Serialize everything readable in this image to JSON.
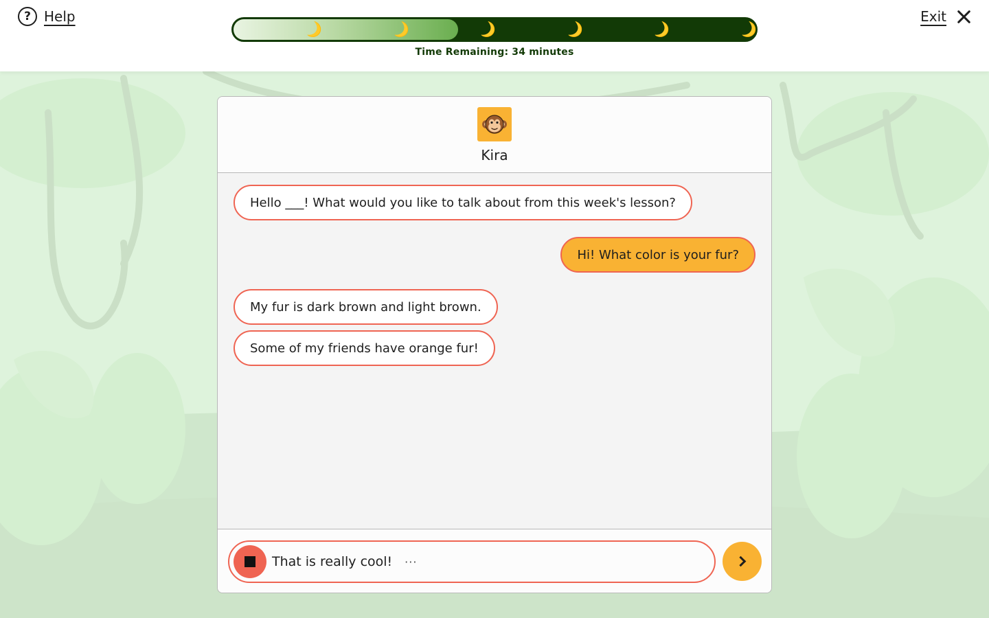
{
  "header": {
    "help_label": "Help",
    "help_icon_glyph": "?",
    "exit_label": "Exit",
    "time_remaining": "Time Remaining: 34 minutes",
    "progress_fraction": 0.43,
    "milestone_count": 6,
    "milestone_icon": "banana-icon",
    "milestone_glyph": "🌙"
  },
  "chat": {
    "bot_name": "Kira",
    "avatar_icon": "monkey-icon",
    "messages": [
      {
        "sender": "bot",
        "text": "Hello ___! What would you like to talk about from this week's lesson?"
      },
      {
        "sender": "user",
        "text": "Hi! What color is your fur?"
      },
      {
        "sender": "bot",
        "text": "My fur is dark brown and light brown."
      },
      {
        "sender": "bot",
        "text": "Some of my friends have orange fur!"
      }
    ]
  },
  "composer": {
    "input_value": "That is really cool!",
    "typing_indicator": "···",
    "stop_icon": "stop-icon",
    "send_icon": "chevron-right-icon"
  },
  "colors": {
    "accent_orange": "#f9b233",
    "bubble_border": "#ef6452",
    "progress_dark": "#123a06",
    "progress_fill": "#6aae4f",
    "background": "#dff3df"
  }
}
